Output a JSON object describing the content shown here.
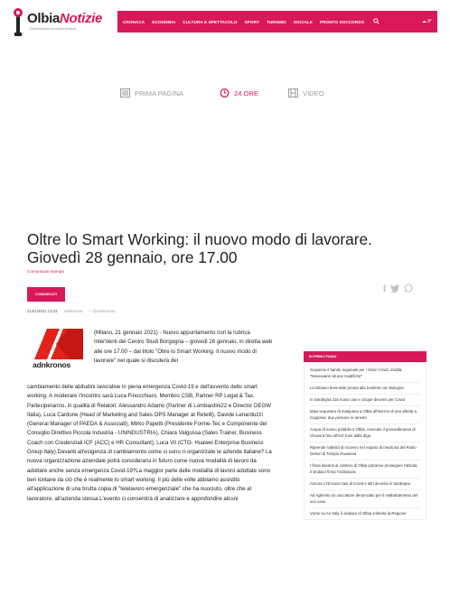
{
  "header": {
    "logo_olbia": "Olbia",
    "logo_notizie": "Notizie",
    "tagline": "L'informazione sul nostro territorio",
    "nav_items": [
      "CRONACA",
      "ECONOMIA",
      "CULTURA E SPETTACOLO",
      "SPORT",
      "TURISMO",
      "SOCIALE",
      "PRONTO SOCCORSO"
    ],
    "weather": "☁ 8°"
  },
  "tabs": [
    {
      "label": "PRIMA PAGINA",
      "icon": "newspaper-icon"
    },
    {
      "label": "24 ORE",
      "icon": "clock-24-icon"
    },
    {
      "label": "VIDEO",
      "icon": "film-icon"
    }
  ],
  "article": {
    "title": "Oltre lo Smart Working: il nuovo modo di lavorare. Giovedì 28 gennaio, ore 17.00",
    "category": "Comunicato stampa",
    "badge": "COMUNICATI",
    "date": "21/01/2021 13:23",
    "author": "Adnkronos",
    "twitter": "@Adnkronos",
    "source_logo": "adnkronos",
    "body_top": "(Milano, 21 gennaio 2021) - Nuovo appuntamento con la rubrica InterVenti del Centro Studi Borgogna – giovedì 28 gennaio, in diretta web alle ore 17.00 – dal titolo \"Oltre lo Smart Working. Il nuovo modo di lavorare\" nel quale si discuterà del",
    "body_rest": "cambiamento delle abitudini lavorative in piena emergenza Covid-19 e dell'avvento dello smart working. A moderare l'incontro sarà Luca Finocchiaro, Membro CSB, Partner RP Legal & Tax. Parteciperanno, in qualità di Relatori: Alessandro Adamo (Partner di Lombardini22 e Director DEGW Italia), Luca Cardone (Head of Marketing and Sales OPS Manager at Reteilt), Davide Lenarduzzi (General Manager of PAEDA & Associati), Mirko Papetti (Presidente Forme-Tec e Componente del Consiglio Direttivo Piccola Industria - UNINDUSTRIA), Chiara Valgussa (Sales Trainer, Business Coach con Credenziali ICF (ACC) e HR Consultant), Luca Vit (CTO- Huawei Enterprise Business Group Italy).Davanti all'esigenza di cambiamento come si sono ri-organizzate le aziende italiane? La nuova organizzazione aziendale potrà considerarsi in futuro come nuova modalità di lavoro da adottare anche senza emergenza Covid-19?La maggior parte delle modalità di lavoro adottate sono ben lontane da ciò che è realmente lo smart working. Il più delle volte abbiamo assistito all'applicazione di una brutta copia di \"telelavoro emergenziale\" che ha nuociuto, oltre che al lavoratore, all'azienda stessa.L'evento ci consentirà di analizzare e approfondire alcuni"
  },
  "sidebar": {
    "header": "IN PRIMO PIANO",
    "items": [
      "Scoperse il bando regionale per i ristori Covid, Zedda: \"Necessarie alcune modifiche\"",
      "La Dinamo femminile pronta alla trasferta con Bologna",
      "In Sardegna 216 nuovi casi e cinque decessi per Covid",
      "Maxi sequestro di marijuana a Olbia all'interno di una villetta a Cugnana: due persone in arresto",
      "Acqua di nuovo potabile a Olbia, revocato il provvedimento di chiusura fino all'Asl: fuori dalla diga",
      "Riprende l'attività di ricovero nel reparto di medicina del Paolo Dettori di Tempio Pausania",
      "I fiorai davanti al cimitero di Olbia potranno proseguire l'attività, il sindaco firma l'ordinanza",
      "Ancora 178 nuovi casi di Covid e altri decessi in Sardegna",
      "Ad Agliientu un cacciatore denunciato per il maltrattamento del suo cane",
      "Vorrei su Air Italy, il sindaco di Olbia sollecita la Regione"
    ]
  },
  "colors": {
    "accent": "#d8185b",
    "text": "#222222",
    "muted": "#9a9a9a"
  }
}
